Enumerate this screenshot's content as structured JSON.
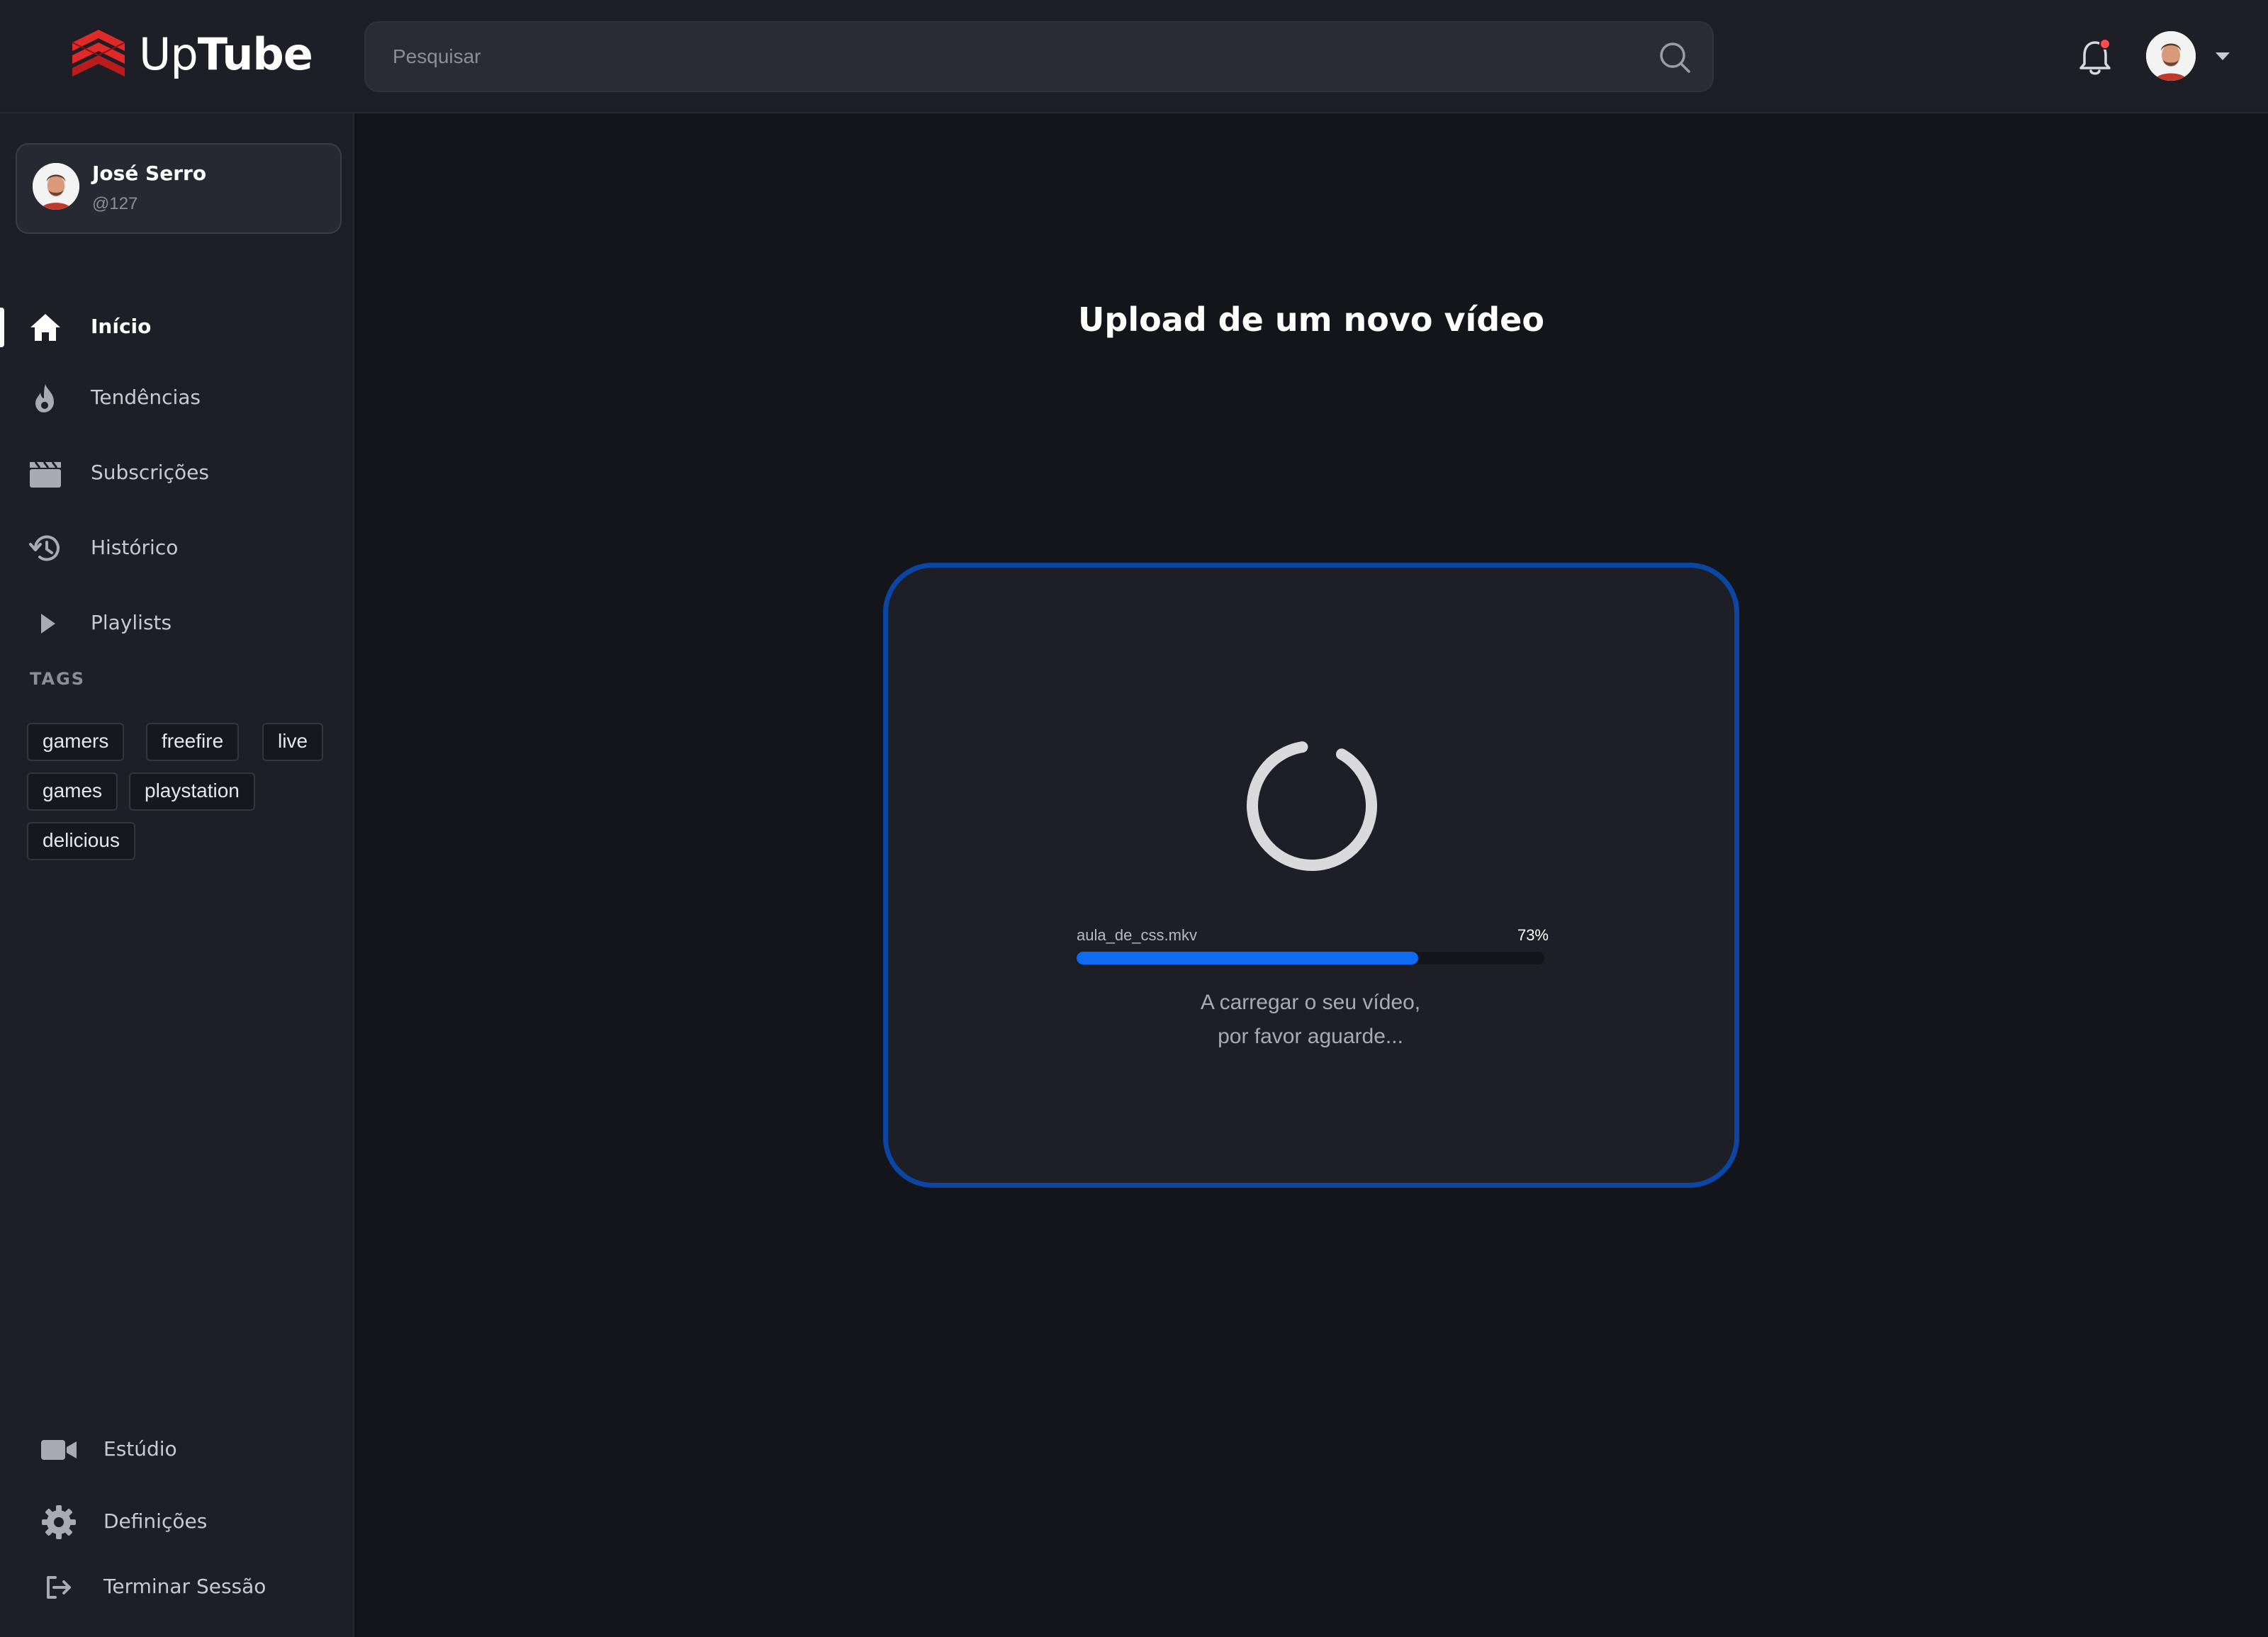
{
  "app": {
    "logo_up": "Up",
    "logo_tube": "Tube"
  },
  "header": {
    "search_placeholder": "Pesquisar",
    "notifications_unread": true
  },
  "user": {
    "name": "José Serro",
    "handle": "@127"
  },
  "sidebar": {
    "items": [
      {
        "label": "Início",
        "icon": "home-icon",
        "active": true
      },
      {
        "label": "Tendências",
        "icon": "flame-icon",
        "active": false
      },
      {
        "label": "Subscrições",
        "icon": "clapperboard-icon",
        "active": false
      },
      {
        "label": "Histórico",
        "icon": "history-icon",
        "active": false
      },
      {
        "label": "Playlists",
        "icon": "play-icon",
        "active": false
      }
    ],
    "tags_title": "TAGS",
    "tags": [
      "gamers",
      "freefire",
      "live",
      "games",
      "playstation",
      "delicious"
    ],
    "bottom_items": [
      {
        "label": "Estúdio",
        "icon": "video-camera-icon"
      },
      {
        "label": "Definições",
        "icon": "gear-icon"
      },
      {
        "label": "Terminar Sessão",
        "icon": "logout-icon"
      }
    ]
  },
  "main": {
    "title": "Upload de um novo vídeo",
    "upload": {
      "file_name": "aula_de_css.mkv",
      "percent_label": "73%",
      "progress": 0.73,
      "message_line1": "A carregar o seu vídeo,",
      "message_line2": "por favor aguarde..."
    }
  },
  "colors": {
    "accent_blue": "#0d6cf2",
    "border_blue": "#0b46a5",
    "brand_red": "#e02a2a",
    "background": "#13151a",
    "panel": "#1d1e26"
  }
}
